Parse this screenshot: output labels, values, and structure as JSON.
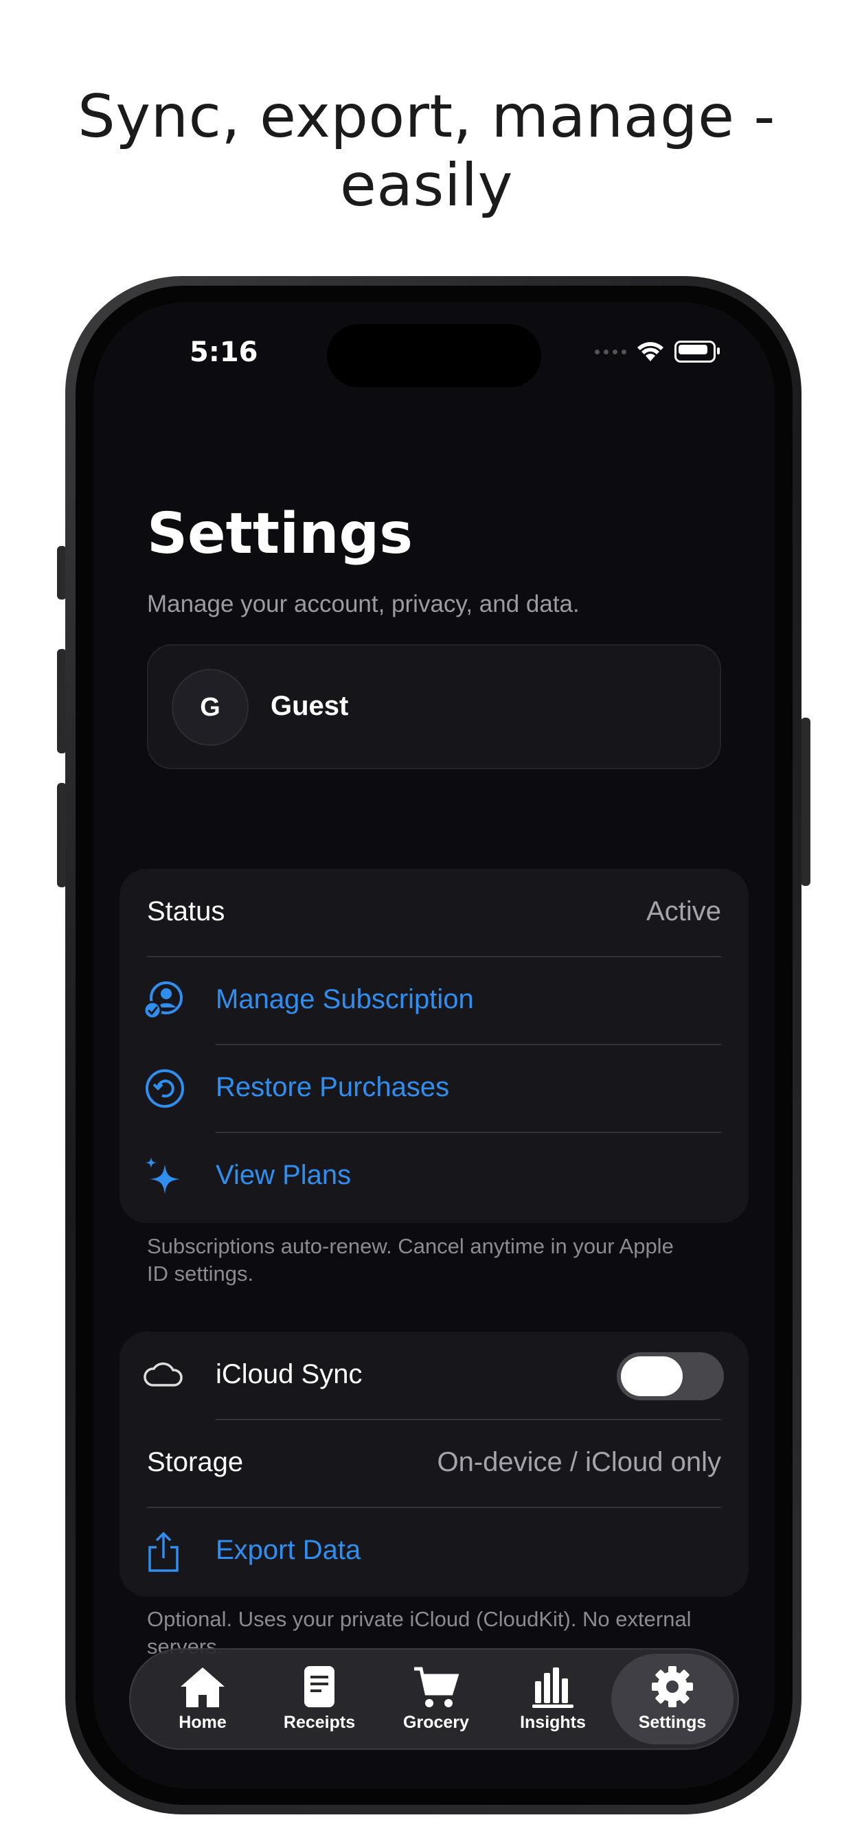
{
  "headline": "Sync, export, manage - easily",
  "status_bar": {
    "time": "5:16"
  },
  "page": {
    "title": "Settings",
    "subtitle": "Manage your account, privacy, and data."
  },
  "account": {
    "initial": "G",
    "name": "Guest"
  },
  "subscription": {
    "status_label": "Status",
    "status_value": "Active",
    "manage": "Manage Subscription",
    "restore": "Restore Purchases",
    "plans": "View Plans",
    "footnote": "Subscriptions auto-renew. Cancel anytime in your Apple ID settings."
  },
  "data": {
    "icloud_label": "iCloud Sync",
    "icloud_enabled": false,
    "storage_label": "Storage",
    "storage_value": "On-device / iCloud only",
    "export": "Export Data",
    "footnote": "Optional. Uses your private iCloud (CloudKit). No external servers."
  },
  "tabbar": {
    "home": "Home",
    "receipts": "Receipts",
    "grocery": "Grocery",
    "insights": "Insights",
    "settings": "Settings",
    "active": "settings"
  },
  "colors": {
    "accent": "#2e8ff0",
    "background": "#0c0c10",
    "card": "#17171b"
  }
}
